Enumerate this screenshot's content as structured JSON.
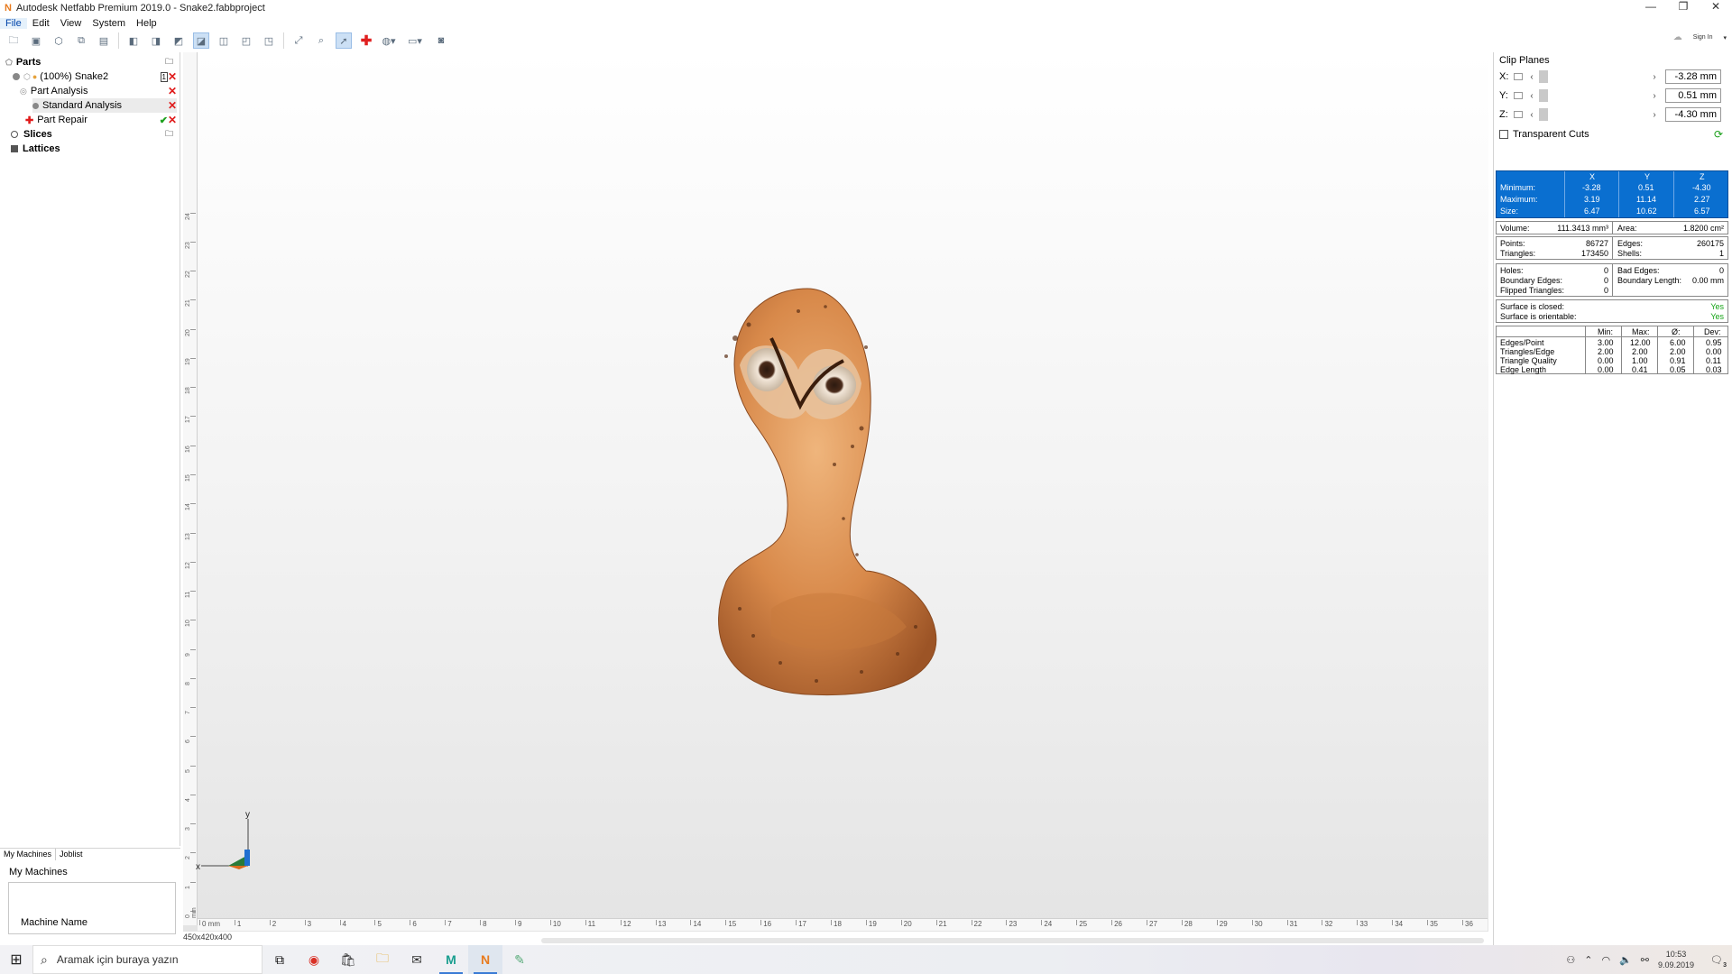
{
  "window": {
    "title": "Autodesk Netfabb Premium 2019.0 - Snake2.fabbproject",
    "controls": [
      "—",
      "❐",
      "✕"
    ]
  },
  "menu": [
    "File",
    "Edit",
    "View",
    "System",
    "Help"
  ],
  "toolbar": {
    "sign_in": "Sign In"
  },
  "tree": {
    "parts": "Parts",
    "snake": "(100%) Snake2",
    "part_analysis": "Part Analysis",
    "standard_analysis": "Standard Analysis",
    "part_repair": "Part Repair",
    "slices": "Slices",
    "lattices": "Lattices"
  },
  "bottom_tabs": [
    "My Machines",
    "Joblist"
  ],
  "machines": {
    "header": "My Machines",
    "column": "Machine Name"
  },
  "viewport": {
    "size_label": "450x420x400",
    "axis_x": "x",
    "axis_y": "y",
    "ruler_h": [
      "0 mm",
      "1",
      "2",
      "3",
      "4",
      "5",
      "6",
      "7",
      "8",
      "9",
      "10",
      "11",
      "12",
      "13",
      "14",
      "15",
      "16",
      "17",
      "18",
      "19",
      "20",
      "21",
      "22",
      "23",
      "24",
      "25",
      "26",
      "27",
      "28",
      "29",
      "30",
      "31",
      "32",
      "33",
      "34",
      "35",
      "36"
    ],
    "ruler_v": [
      "0 mm",
      "1",
      "2",
      "3",
      "4",
      "5",
      "6",
      "7",
      "8",
      "9",
      "10",
      "11",
      "12",
      "13",
      "14",
      "15",
      "16",
      "17",
      "18",
      "19",
      "20",
      "21",
      "22",
      "23",
      "24"
    ]
  },
  "clip_planes": {
    "title": "Clip Planes",
    "rows": [
      {
        "label": "X:",
        "value": "-3.28 mm"
      },
      {
        "label": "Y:",
        "value": "0.51 mm"
      },
      {
        "label": "Z:",
        "value": "-4.30 mm"
      }
    ],
    "transparent_cuts": "Transparent Cuts"
  },
  "analysis": {
    "bbox": {
      "headers": [
        "X",
        "Y",
        "Z"
      ],
      "rows": [
        {
          "label": "Minimum:",
          "values": [
            "-3.28",
            "0.51",
            "-4.30"
          ]
        },
        {
          "label": "Maximum:",
          "values": [
            "3.19",
            "11.14",
            "2.27"
          ]
        },
        {
          "label": "Size:",
          "values": [
            "6.47",
            "10.62",
            "6.57"
          ]
        }
      ]
    },
    "volume_label": "Volume:",
    "volume": "111.3413 mm³",
    "area_label": "Area:",
    "area": "1.8200 cm²",
    "points_label": "Points:",
    "points": "86727",
    "edges_label": "Edges:",
    "edges": "260175",
    "triangles_label": "Triangles:",
    "triangles": "173450",
    "shells_label": "Shells:",
    "shells": "1",
    "holes_label": "Holes:",
    "holes": "0",
    "bad_edges_label": "Bad Edges:",
    "bad_edges": "0",
    "boundary_edges_label": "Boundary Edges:",
    "boundary_edges": "0",
    "boundary_length_label": "Boundary Length:",
    "boundary_length": "0.00 mm",
    "flipped_label": "Flipped Triangles:",
    "flipped": "0",
    "closed_label": "Surface is closed:",
    "closed": "Yes",
    "orientable_label": "Surface is orientable:",
    "orientable": "Yes",
    "stats": {
      "headers": [
        "Min:",
        "Max:",
        "Ø:",
        "Dev:"
      ],
      "rows": [
        {
          "label": "Edges/Point",
          "values": [
            "3.00",
            "12.00",
            "6.00",
            "0.95"
          ]
        },
        {
          "label": "Triangles/Edge",
          "values": [
            "2.00",
            "2.00",
            "2.00",
            "0.00"
          ]
        },
        {
          "label": "Triangle Quality",
          "values": [
            "0.00",
            "1.00",
            "0.91",
            "0.11"
          ]
        },
        {
          "label": "Edge Length",
          "values": [
            "0.00",
            "0.41",
            "0.05",
            "0.03"
          ]
        }
      ]
    }
  },
  "taskbar": {
    "search_placeholder": "Aramak için buraya yazın",
    "time": "10:53",
    "date": "9.09.2019",
    "notification_count": "3"
  },
  "colors": {
    "accent": "#0a6fd0",
    "ok": "#16a316",
    "error": "#e01b1b",
    "model": "#d8894a"
  }
}
